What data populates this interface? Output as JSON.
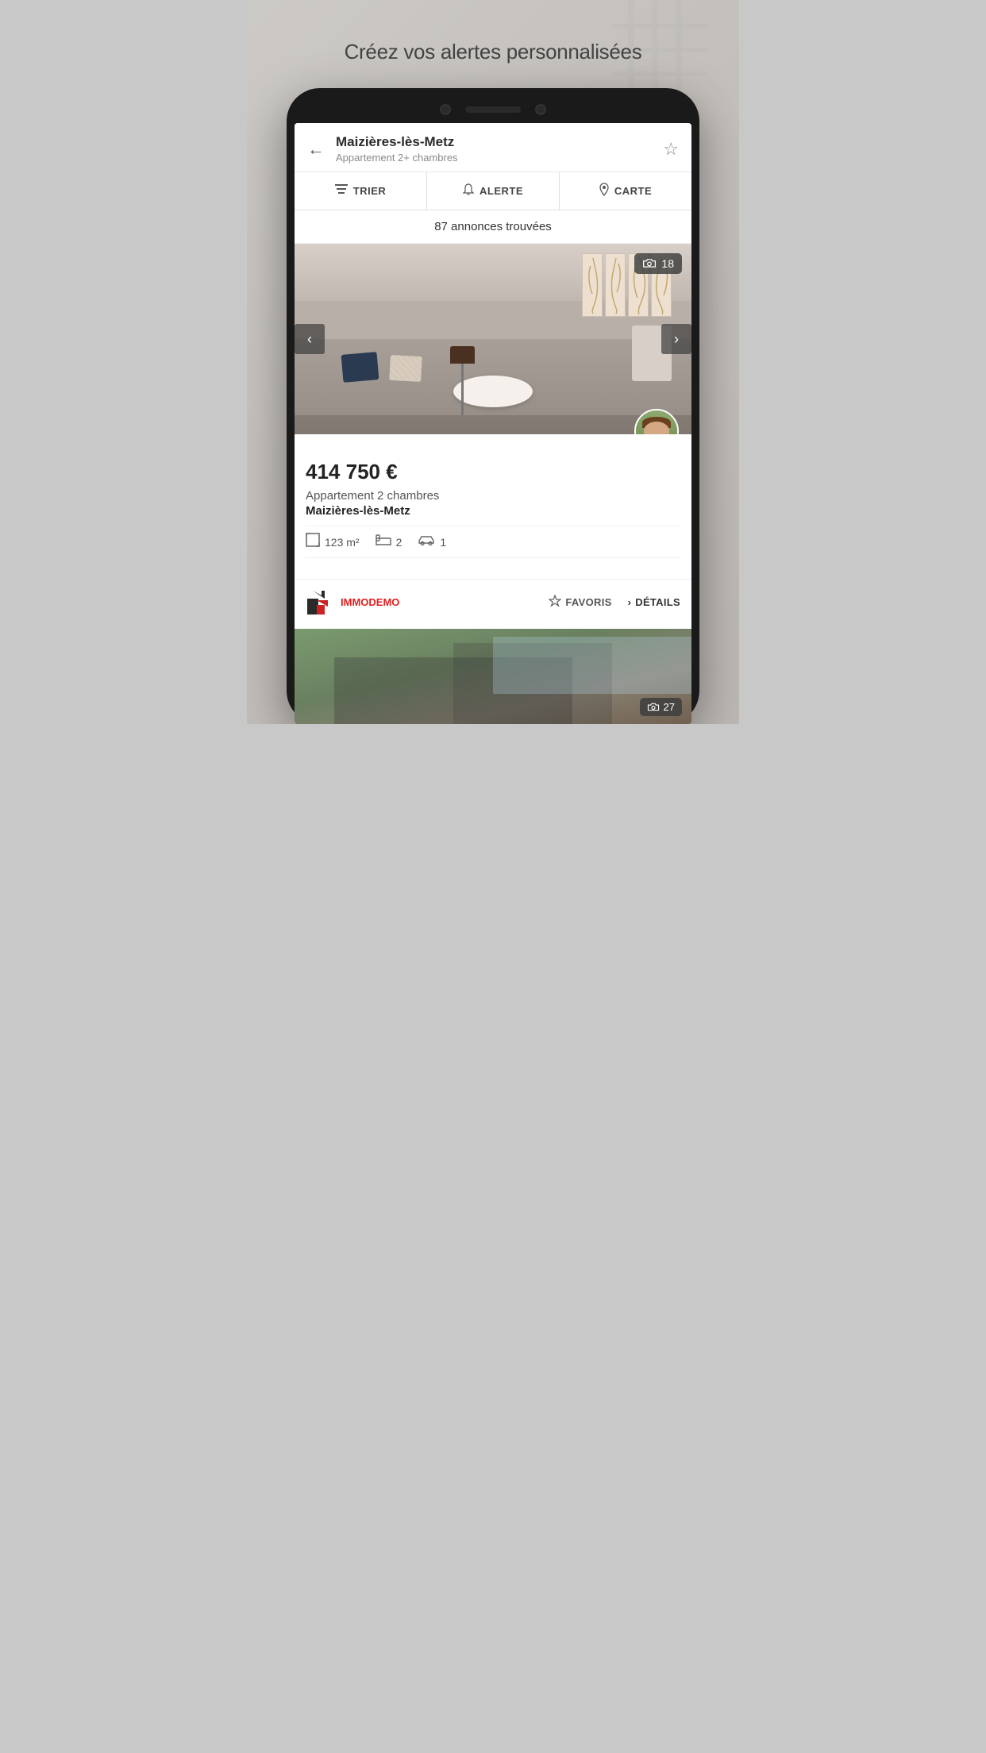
{
  "page": {
    "title": "Créez vos alertes personnalisées"
  },
  "header": {
    "city": "Maizières-lès-Metz",
    "subtitle": "Appartement 2+ chambres",
    "back_label": "←",
    "fav_label": "☆"
  },
  "toolbar": {
    "trier_label": "TRIER",
    "alerte_label": "ALERTE",
    "carte_label": "CARTE"
  },
  "results": {
    "count_text": "87 annonces trouvées"
  },
  "listing": {
    "photo_count": "18",
    "photo_count2": "27",
    "price": "414 750 €",
    "type": "Appartement 2 chambres",
    "location": "Maizières-lès-Metz",
    "surface": "123 m²",
    "bedrooms": "2",
    "parking": "1",
    "agency_name1": "IMMO",
    "agency_name2": "DEMO",
    "fav_label": "FAVORIS",
    "details_label": "DÉTAILS"
  }
}
